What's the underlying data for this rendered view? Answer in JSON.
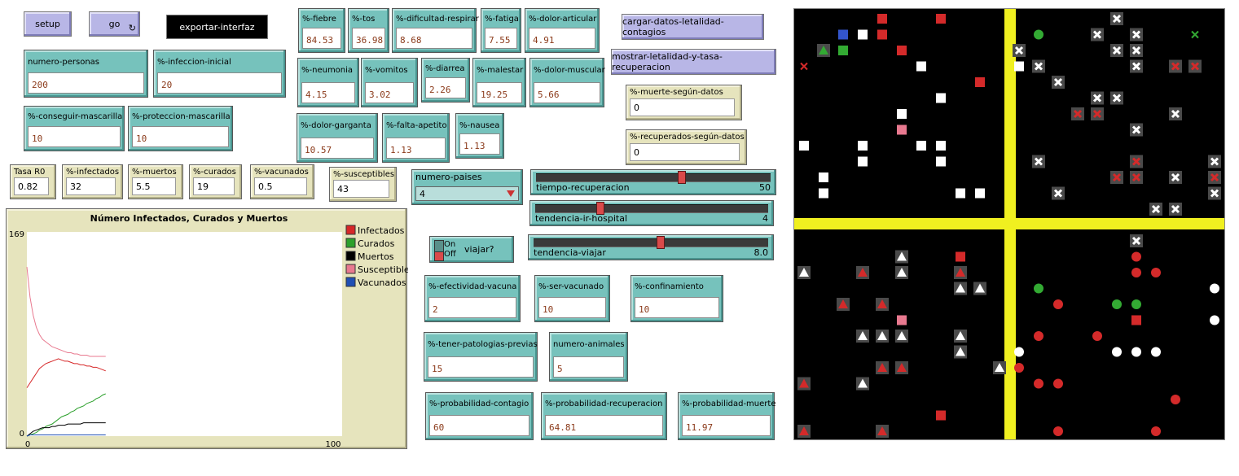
{
  "buttons": {
    "setup": "setup",
    "go": "go",
    "exportar": "exportar-interfaz",
    "cargar": "cargar-datos-letalidad-contagios",
    "mostrar": "mostrar-letalidad-y-tasa-recuperacion"
  },
  "inputs": {
    "numero_personas": {
      "label": "numero-personas",
      "value": "200"
    },
    "infeccion_inicial": {
      "label": "%-infeccion-inicial",
      "value": "20"
    },
    "conseguir_mascarilla": {
      "label": "%-conseguir-mascarilla",
      "value": "10"
    },
    "proteccion_mascarilla": {
      "label": "%-proteccion-mascarilla",
      "value": "10"
    },
    "fiebre": {
      "label": "%-fiebre",
      "value": "84.53"
    },
    "tos": {
      "label": "%-tos",
      "value": "36.98"
    },
    "dificultad_respirar": {
      "label": "%-dificultad-respirar",
      "value": "8.68"
    },
    "fatiga": {
      "label": "%-fatiga",
      "value": "7.55"
    },
    "dolor_articular": {
      "label": "%-dolor-articular",
      "value": "4.91"
    },
    "neumonia": {
      "label": "%-neumonia",
      "value": "4.15"
    },
    "vomitos": {
      "label": "%-vomitos",
      "value": "3.02"
    },
    "diarrea": {
      "label": "%-diarrea",
      "value": "2.26"
    },
    "malestar": {
      "label": "%-malestar",
      "value": "19.25"
    },
    "dolor_muscular": {
      "label": "%-dolor-muscular",
      "value": "5.66"
    },
    "dolor_garganta": {
      "label": "%-dolor-garganta",
      "value": "10.57"
    },
    "falta_apetito": {
      "label": "%-falta-apetito",
      "value": "1.13"
    },
    "nausea": {
      "label": "%-nausea",
      "value": "1.13"
    },
    "efectividad_vacuna": {
      "label": "%-efectividad-vacuna",
      "value": "2"
    },
    "ser_vacunado": {
      "label": "%-ser-vacunado",
      "value": "10"
    },
    "confinamiento": {
      "label": "%-confinamiento",
      "value": "10"
    },
    "patologias_previas": {
      "label": "%-tener-patologias-previas",
      "value": "15"
    },
    "numero_animales": {
      "label": "numero-animales",
      "value": "5"
    },
    "prob_contagio": {
      "label": "%-probabilidad-contagio",
      "value": "60"
    },
    "prob_recuperacion": {
      "label": "%-probabilidad-recuperacion",
      "value": "64.81"
    },
    "prob_muerte": {
      "label": "%-probabilidad-muerte",
      "value": "11.97"
    }
  },
  "monitors": {
    "tasa_r0": {
      "label": "Tasa R0",
      "value": "0.82"
    },
    "infectados": {
      "label": "%-infectados",
      "value": "32"
    },
    "muertos": {
      "label": "%-muertos",
      "value": "5.5"
    },
    "curados": {
      "label": "%-curados",
      "value": "19"
    },
    "vacunados": {
      "label": "%-vacunados",
      "value": "0.5"
    },
    "susceptibles": {
      "label": "%-susceptibles",
      "value": "43"
    },
    "muerte_datos": {
      "label": "%-muerte-según-datos",
      "value": "0"
    },
    "recuperados_datos": {
      "label": "%-recuperados-según-datos",
      "value": "0"
    }
  },
  "chooser": {
    "label": "numero-paises",
    "value": "4"
  },
  "sliders": {
    "tiempo_recuperacion": {
      "label": "tiempo-recuperacion",
      "value": "50",
      "fraction": 0.62
    },
    "tendencia_hospital": {
      "label": "tendencia-ir-hospital",
      "value": "4",
      "fraction": 0.27
    },
    "tendencia_viajar": {
      "label": "tendencia-viajar",
      "value": "8.0",
      "fraction": 0.54
    }
  },
  "switch": {
    "label": "viajar?",
    "on": "On",
    "off": "Off"
  },
  "chart_data": {
    "type": "line",
    "title": "Número Infectados, Curados y Muertos",
    "xlim": [
      0,
      100
    ],
    "ylim": [
      0,
      169
    ],
    "x_ticks": [
      "0",
      "100"
    ],
    "y_ticks": [
      "169",
      "0"
    ],
    "grid": false,
    "legend_position": "right",
    "x": [
      0,
      1,
      2,
      3,
      4,
      5,
      6,
      7,
      8,
      9,
      10,
      11,
      12,
      13,
      14,
      15,
      16,
      17,
      18,
      19,
      20,
      21,
      22,
      23,
      24,
      25
    ],
    "series": [
      {
        "name": "Infectados",
        "color": "#d62728",
        "values": [
          40,
          44,
          48,
          52,
          56,
          58,
          60,
          61,
          62,
          63,
          64,
          63,
          62,
          62,
          61,
          60,
          60,
          59,
          59,
          58,
          58,
          57,
          57,
          56,
          55,
          54
        ]
      },
      {
        "name": "Curados",
        "color": "#2ca02c",
        "values": [
          0,
          1,
          2,
          3,
          5,
          6,
          8,
          9,
          10,
          12,
          14,
          16,
          17,
          18,
          20,
          21,
          23,
          24,
          25,
          27,
          28,
          29,
          31,
          32,
          34,
          35
        ]
      },
      {
        "name": "Muertos",
        "color": "#000000",
        "values": [
          0,
          2,
          4,
          5,
          6,
          7,
          7,
          7,
          8,
          8,
          9,
          9,
          9,
          10,
          10,
          10,
          10,
          10,
          11,
          11,
          11,
          11,
          11,
          11,
          11,
          11
        ]
      },
      {
        "name": "Susceptibles",
        "color": "#e8798f",
        "values": [
          140,
          115,
          100,
          90,
          84,
          80,
          78,
          76,
          74,
          73,
          72,
          71,
          70,
          69,
          69,
          68,
          68,
          67,
          67,
          67,
          66,
          66,
          66,
          66,
          66,
          66
        ]
      },
      {
        "name": "Vacunados",
        "color": "#1f4fb4",
        "values": [
          0,
          1,
          1,
          1,
          1,
          1,
          1,
          1,
          1,
          1,
          1,
          1,
          1,
          1,
          1,
          1,
          1,
          1,
          1,
          1,
          1,
          1,
          1,
          1,
          1,
          1
        ]
      }
    ]
  },
  "world": {
    "background": "#000000",
    "road_color": "#f0f020",
    "agents": [
      {
        "shape": "square",
        "color": "#d42a2a",
        "col": 4,
        "row": 0
      },
      {
        "shape": "square",
        "color": "#d42a2a",
        "col": 7,
        "row": 0
      },
      {
        "shape": "cross",
        "color": "#ffffff",
        "col": 16,
        "row": 0
      },
      {
        "shape": "square",
        "color": "#ffffff",
        "col": 3,
        "row": 1
      },
      {
        "shape": "square",
        "color": "#d42a2a",
        "col": 4,
        "row": 1
      },
      {
        "shape": "circle",
        "color": "#33aa33",
        "col": 12,
        "row": 1
      },
      {
        "shape": "cross",
        "color": "#ffffff",
        "col": 15,
        "row": 1
      },
      {
        "shape": "cross",
        "color": "#ffffff",
        "col": 17,
        "row": 1
      },
      {
        "shape": "x",
        "color": "#33aa33",
        "col": 20,
        "row": 1
      },
      {
        "shape": "square",
        "color": "#3355cc",
        "col": 2,
        "row": 1
      },
      {
        "shape": "triangle",
        "color": "#33aa33",
        "col": 1,
        "row": 2
      },
      {
        "shape": "square",
        "color": "#33aa33",
        "col": 2,
        "row": 2
      },
      {
        "shape": "square",
        "color": "#d42a2a",
        "col": 5,
        "row": 2
      },
      {
        "shape": "cross",
        "color": "#ffffff",
        "col": 11,
        "row": 2
      },
      {
        "shape": "cross",
        "color": "#ffffff",
        "col": 16,
        "row": 2
      },
      {
        "shape": "cross",
        "color": "#ffffff",
        "col": 17,
        "row": 2
      },
      {
        "shape": "x",
        "color": "#d42a2a",
        "col": 0,
        "row": 3
      },
      {
        "shape": "square",
        "color": "#ffffff",
        "col": 6,
        "row": 3
      },
      {
        "shape": "square",
        "color": "#ffffff",
        "col": 11,
        "row": 3
      },
      {
        "shape": "cross",
        "color": "#ffffff",
        "col": 12,
        "row": 3
      },
      {
        "shape": "cross",
        "color": "#ffffff",
        "col": 17,
        "row": 3
      },
      {
        "shape": "cross",
        "color": "#d42a2a",
        "col": 19,
        "row": 3
      },
      {
        "shape": "cross",
        "color": "#d42a2a",
        "col": 20,
        "row": 3
      },
      {
        "shape": "square",
        "color": "#d42a2a",
        "col": 9,
        "row": 4
      },
      {
        "shape": "cross",
        "color": "#ffffff",
        "col": 13,
        "row": 4
      },
      {
        "shape": "square",
        "color": "#ffffff",
        "col": 7,
        "row": 5
      },
      {
        "shape": "cross",
        "color": "#ffffff",
        "col": 15,
        "row": 5
      },
      {
        "shape": "cross",
        "color": "#ffffff",
        "col": 16,
        "row": 5
      },
      {
        "shape": "square",
        "color": "#ffffff",
        "col": 5,
        "row": 6
      },
      {
        "shape": "square",
        "color": "#e8798f",
        "col": 5,
        "row": 7
      },
      {
        "shape": "cross",
        "color": "#d42a2a",
        "col": 14,
        "row": 6
      },
      {
        "shape": "cross",
        "color": "#d42a2a",
        "col": 15,
        "row": 6
      },
      {
        "shape": "cross",
        "color": "#ffffff",
        "col": 19,
        "row": 6
      },
      {
        "shape": "square",
        "color": "#ffffff",
        "col": 0,
        "row": 8
      },
      {
        "shape": "square",
        "color": "#ffffff",
        "col": 3,
        "row": 8
      },
      {
        "shape": "square",
        "color": "#ffffff",
        "col": 6,
        "row": 8
      },
      {
        "shape": "square",
        "color": "#ffffff",
        "col": 7,
        "row": 8
      },
      {
        "shape": "cross",
        "color": "#ffffff",
        "col": 17,
        "row": 7
      },
      {
        "shape": "square",
        "color": "#ffffff",
        "col": 3,
        "row": 9
      },
      {
        "shape": "square",
        "color": "#ffffff",
        "col": 7,
        "row": 9
      },
      {
        "shape": "cross",
        "color": "#ffffff",
        "col": 12,
        "row": 9
      },
      {
        "shape": "cross",
        "color": "#d42a2a",
        "col": 17,
        "row": 9
      },
      {
        "shape": "cross",
        "color": "#ffffff",
        "col": 21,
        "row": 9
      },
      {
        "shape": "square",
        "color": "#ffffff",
        "col": 1,
        "row": 10
      },
      {
        "shape": "cross",
        "color": "#d42a2a",
        "col": 16,
        "row": 10
      },
      {
        "shape": "cross",
        "color": "#d42a2a",
        "col": 17,
        "row": 10
      },
      {
        "shape": "cross",
        "color": "#ffffff",
        "col": 19,
        "row": 10
      },
      {
        "shape": "cross",
        "color": "#d42a2a",
        "col": 21,
        "row": 10
      },
      {
        "shape": "square",
        "color": "#ffffff",
        "col": 1,
        "row": 11
      },
      {
        "shape": "square",
        "color": "#ffffff",
        "col": 8,
        "row": 11
      },
      {
        "shape": "square",
        "color": "#ffffff",
        "col": 9,
        "row": 11
      },
      {
        "shape": "cross",
        "color": "#ffffff",
        "col": 13,
        "row": 11
      },
      {
        "shape": "cross",
        "color": "#ffffff",
        "col": 21,
        "row": 11
      },
      {
        "shape": "cross",
        "color": "#ffffff",
        "col": 18,
        "row": 12
      },
      {
        "shape": "cross",
        "color": "#ffffff",
        "col": 19,
        "row": 12
      },
      {
        "shape": "cross",
        "color": "#ffffff",
        "col": 17,
        "row": 14
      },
      {
        "shape": "triangle",
        "color": "#ffffff",
        "col": 5,
        "row": 15
      },
      {
        "shape": "square",
        "color": "#d42a2a",
        "col": 8,
        "row": 15
      },
      {
        "shape": "square",
        "color": "#d42a2a",
        "col": 8,
        "row": 16
      },
      {
        "shape": "circle",
        "color": "#d42a2a",
        "col": 17,
        "row": 15
      },
      {
        "shape": "circle",
        "color": "#d42a2a",
        "col": 17,
        "row": 16
      },
      {
        "shape": "circle",
        "color": "#d42a2a",
        "col": 18,
        "row": 16
      },
      {
        "shape": "triangle",
        "color": "#ffffff",
        "col": 0,
        "row": 16
      },
      {
        "shape": "triangle",
        "color": "#d42a2a",
        "col": 3,
        "row": 16
      },
      {
        "shape": "triangle",
        "color": "#ffffff",
        "col": 5,
        "row": 16
      },
      {
        "shape": "triangle",
        "color": "#d42a2a",
        "col": 8,
        "row": 16
      },
      {
        "shape": "triangle",
        "color": "#ffffff",
        "col": 8,
        "row": 17
      },
      {
        "shape": "triangle",
        "color": "#ffffff",
        "col": 9,
        "row": 17
      },
      {
        "shape": "circle",
        "color": "#33aa33",
        "col": 12,
        "row": 17
      },
      {
        "shape": "circle",
        "color": "#ffffff",
        "col": 21,
        "row": 17
      },
      {
        "shape": "triangle",
        "color": "#d42a2a",
        "col": 2,
        "row": 18
      },
      {
        "shape": "triangle",
        "color": "#d42a2a",
        "col": 4,
        "row": 18
      },
      {
        "shape": "circle",
        "color": "#d42a2a",
        "col": 13,
        "row": 18
      },
      {
        "shape": "circle",
        "color": "#33aa33",
        "col": 16,
        "row": 18
      },
      {
        "shape": "circle",
        "color": "#33aa33",
        "col": 17,
        "row": 18
      },
      {
        "shape": "square",
        "color": "#e8798f",
        "col": 5,
        "row": 19
      },
      {
        "shape": "circle",
        "color": "#ffffff",
        "col": 21,
        "row": 19
      },
      {
        "shape": "square",
        "color": "#d42a2a",
        "col": 17,
        "row": 19
      },
      {
        "shape": "triangle",
        "color": "#ffffff",
        "col": 3,
        "row": 20
      },
      {
        "shape": "triangle",
        "color": "#ffffff",
        "col": 4,
        "row": 20
      },
      {
        "shape": "triangle",
        "color": "#ffffff",
        "col": 5,
        "row": 20
      },
      {
        "shape": "triangle",
        "color": "#ffffff",
        "col": 8,
        "row": 20
      },
      {
        "shape": "circle",
        "color": "#d42a2a",
        "col": 12,
        "row": 20
      },
      {
        "shape": "circle",
        "color": "#d42a2a",
        "col": 15,
        "row": 20
      },
      {
        "shape": "triangle",
        "color": "#ffffff",
        "col": 8,
        "row": 21
      },
      {
        "shape": "circle",
        "color": "#ffffff",
        "col": 11,
        "row": 21
      },
      {
        "shape": "circle",
        "color": "#ffffff",
        "col": 16,
        "row": 21
      },
      {
        "shape": "circle",
        "color": "#ffffff",
        "col": 17,
        "row": 21
      },
      {
        "shape": "circle",
        "color": "#ffffff",
        "col": 18,
        "row": 21
      },
      {
        "shape": "triangle",
        "color": "#d42a2a",
        "col": 4,
        "row": 22
      },
      {
        "shape": "triangle",
        "color": "#d42a2a",
        "col": 5,
        "row": 22
      },
      {
        "shape": "triangle",
        "color": "#ffffff",
        "col": 10,
        "row": 22
      },
      {
        "shape": "circle",
        "color": "#d42a2a",
        "col": 11,
        "row": 22
      },
      {
        "shape": "triangle",
        "color": "#d42a2a",
        "col": 0,
        "row": 23
      },
      {
        "shape": "triangle",
        "color": "#ffffff",
        "col": 3,
        "row": 23
      },
      {
        "shape": "circle",
        "color": "#d42a2a",
        "col": 12,
        "row": 23
      },
      {
        "shape": "circle",
        "color": "#d42a2a",
        "col": 13,
        "row": 23
      },
      {
        "shape": "circle",
        "color": "#d42a2a",
        "col": 19,
        "row": 24
      },
      {
        "shape": "square",
        "color": "#d42a2a",
        "col": 7,
        "row": 25
      },
      {
        "shape": "triangle",
        "color": "#d42a2a",
        "col": 0,
        "row": 26
      },
      {
        "shape": "triangle",
        "color": "#d42a2a",
        "col": 4,
        "row": 26
      },
      {
        "shape": "circle",
        "color": "#d42a2a",
        "col": 13,
        "row": 26
      },
      {
        "shape": "circle",
        "color": "#d42a2a",
        "col": 18,
        "row": 26
      }
    ]
  }
}
